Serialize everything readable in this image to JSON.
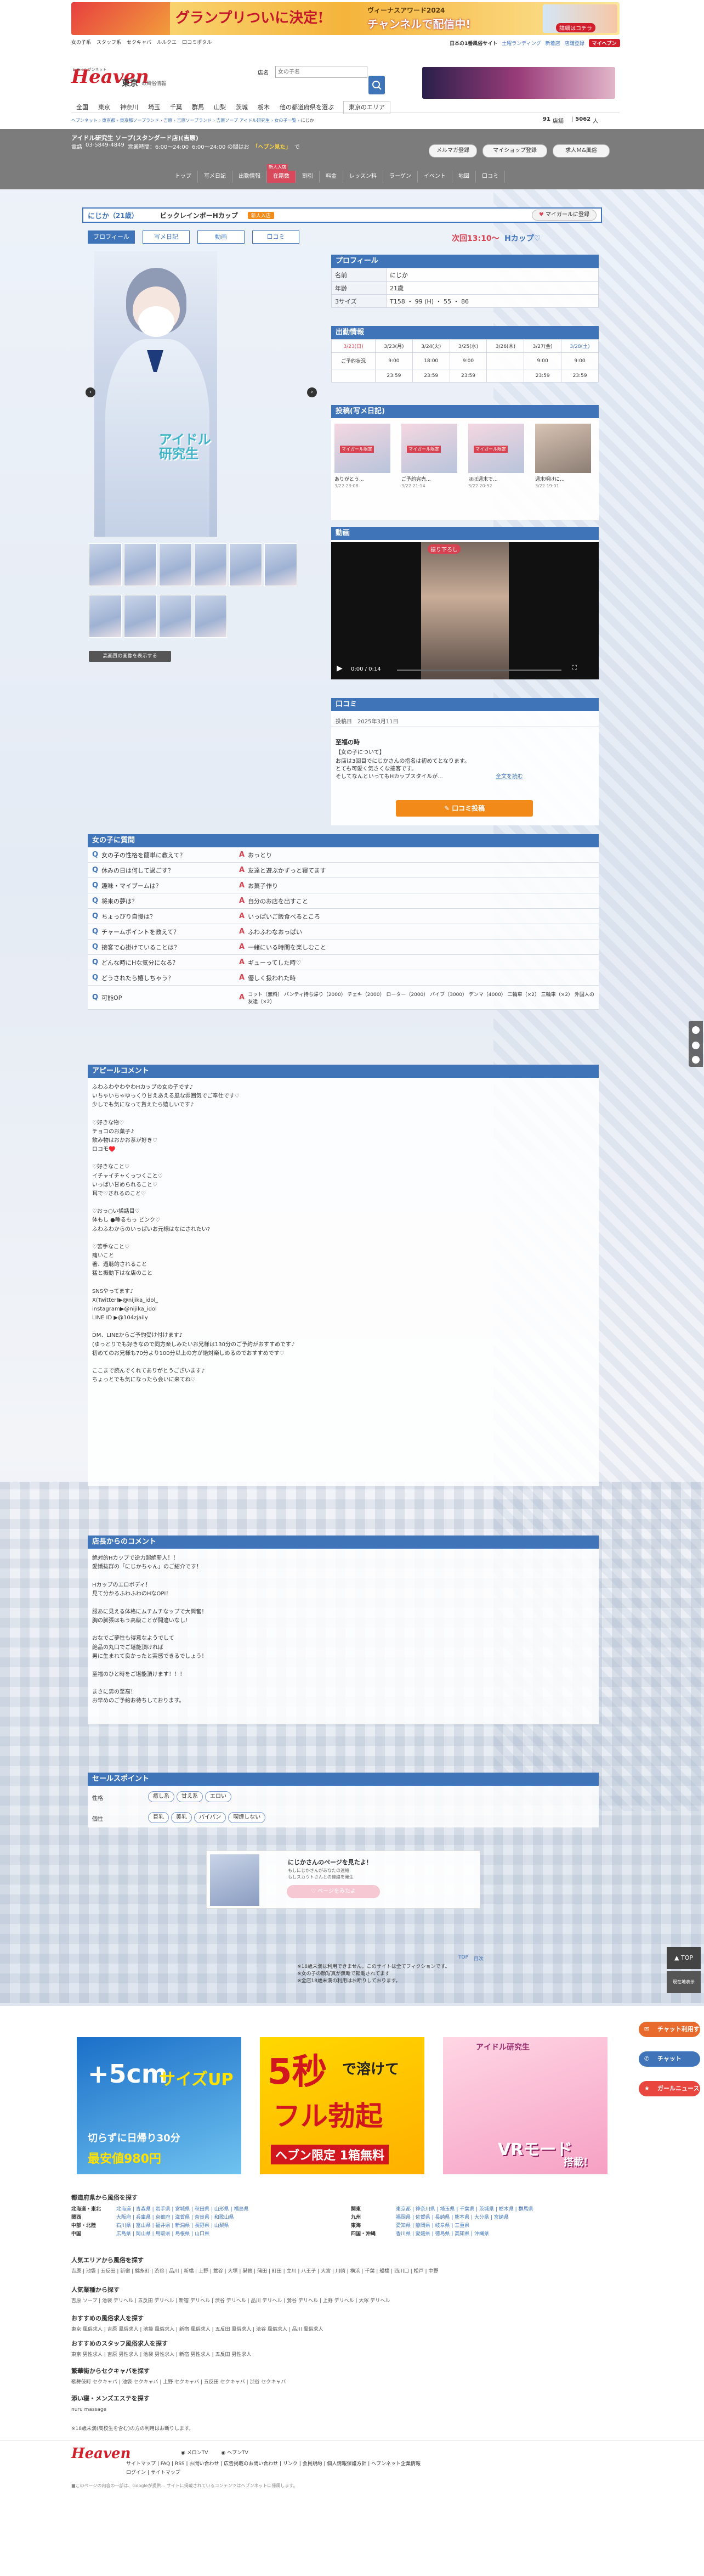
{
  "top_banner": {
    "left_text": "グランプリついに決定!",
    "mid_text": "ヴィーナスアワード2024",
    "right_text": "チャンネルで配信中!",
    "right_sub": "詳細はコチラ"
  },
  "top_links": [
    "女の子系",
    "スタッフ系",
    "セクキャバ",
    "ルルクエ",
    "口コミポタル"
  ],
  "header_promo": {
    "text": "日本の1番風俗サイト",
    "link1": "土曜ランディング",
    "link2": "新着店",
    "link3": "店舗登録"
  },
  "header_promo_badge": "マイヘブン",
  "site": {
    "logo": "Heaven",
    "logo_sub": "シティヘブンネット",
    "region": "東京",
    "region_sub": "の風俗情報"
  },
  "search": {
    "label": "店名",
    "placeholder": "女の子名"
  },
  "nav_items": [
    "全国",
    "東京",
    "神奈川",
    "埼玉",
    "千葉",
    "群馬",
    "山梨",
    "茨城",
    "栃木",
    "他の都道府県を選ぶ",
    "東京のエリア"
  ],
  "breadcrumb": [
    "ヘブンネット",
    "東京都",
    "東京都ソープランド",
    "吉原",
    "吉原ソープランド",
    "吉原ソープ アイドル研究生",
    "女の子一覧",
    "にじか"
  ],
  "counts": {
    "label1": "91",
    "unit1": "店舗",
    "label2": "5062",
    "unit2": "人"
  },
  "shop": {
    "name": "アイドル研究生 ソープ(スタンダード店)(吉原)",
    "tel_label": "電話",
    "tel": "03-5849-4849",
    "hours": "営業時間：6:00～24:00",
    "hours_note": "6:00～24:00 の間はお",
    "highlight": "「ヘブン見た」",
    "highlight_suffix": "で"
  },
  "shop_tabs": [
    "トップ",
    "写メ日記",
    "出勤情報",
    "在籍数",
    "割引",
    "料金",
    "レッスン料",
    "ラーゲン",
    "イベント",
    "地図",
    "口コミ"
  ],
  "shop_tab_badge": "新人入店",
  "header_buttons": {
    "mail": "メルマガ登録",
    "my_shop": "マイショップ登録",
    "recruit": "求人Ｍ&風俗"
  },
  "girl": {
    "name": "にじか",
    "age_tag": "（21歳）",
    "catch": "ビックレインボーHカップ",
    "badge_text": "新人入店",
    "next": "次回13:10～",
    "cup": "Hカップ♡",
    "mygirl_button": "マイガールに登録"
  },
  "profile_tabs": [
    "プロフィール",
    "写メ日記",
    "動画",
    "口コミ"
  ],
  "photo_overlay": "アイドル研究生",
  "photo_button": "高画質の画像を表示する",
  "profile": {
    "title": "プロフィール",
    "rows": [
      {
        "label": "名前",
        "value": "にじか"
      },
      {
        "label": "年齢",
        "value": "21歳"
      },
      {
        "label": "3サイズ",
        "value": "T158 ・ 99 (H) ・ 55 ・ 86"
      }
    ]
  },
  "schedule": {
    "title": "出勤情報",
    "days": [
      "3/23(日)",
      "3/23(月)",
      "3/24(火)",
      "3/25(水)",
      "3/26(木)",
      "3/27(金)",
      "3/28(土)"
    ],
    "row1": [
      "ご予約状況",
      "9:00",
      "18:00",
      "9:00",
      "",
      "9:00",
      "9:00"
    ],
    "row2": [
      "",
      "23:59",
      "23:59",
      "23:59",
      "",
      "23:59",
      "23:59"
    ]
  },
  "diary": {
    "title": "投稿(写メ日記",
    "title_suffix": ")",
    "items": [
      {
        "cap": "ありがとう...",
        "date": "3/22 23:08",
        "tag": "マイガール限定"
      },
      {
        "cap": "ご予約完売...",
        "date": "3/22 21:14",
        "tag": "マイガール限定"
      },
      {
        "cap": "ほぼ週末で...",
        "date": "3/22 20:52",
        "tag": "マイガール限定"
      },
      {
        "cap": "週末明けに...",
        "date": "3/22 19:01",
        "tag": ""
      }
    ]
  },
  "video": {
    "title": "動画",
    "time": "0:00 / 0:14",
    "label": "振り下ろし"
  },
  "review": {
    "title": "口コミ",
    "date_label": "投稿日",
    "date": "2025年3月11日",
    "heading": "至福の時",
    "sub": "【女の子について】",
    "body1": "お店は3回目でにじかさんの指名は初めてとなります。",
    "body2": "とても可愛く気さくな接客です。",
    "body3": "そしてなんといってもHカップスタイルが...",
    "more": "全文を読む",
    "button": "口コミ投稿"
  },
  "qa": {
    "title": "女の子に質問",
    "rows": [
      {
        "q": "女の子の性格を簡単に教えて？",
        "a": "おっとり"
      },
      {
        "q": "休みの日は何して過ごす？",
        "a": "友達と遊ぶかずっと寝てます"
      },
      {
        "q": "趣味・マイブームは？",
        "a": "お菓子作り"
      },
      {
        "q": "将来の夢は？",
        "a": "自分のお店を出すこと"
      },
      {
        "q": "ちょっぴり自慢は？",
        "a": "いっぱいご飯食べるところ"
      },
      {
        "q": "チャームポイントを教えて？",
        "a": "ふわふわなおっぱい"
      },
      {
        "q": "接客で心掛けていることは？",
        "a": "一緒にいる時間を楽しむこと"
      },
      {
        "q": "どんな時にHな気分になる？",
        "a": "ギューってした時♡"
      },
      {
        "q": "どうされたら嬉しちゃう？",
        "a": "優しく扱われた時"
      },
      {
        "q": "可能OP",
        "a": "コット（無料） パンティ持ち帰り（2000） チェキ（2000） ローター（2000） バイブ（3000） デンマ（4000） 二輪車（×2） 三輪車（×2） 外国人の友達（×2）"
      }
    ]
  },
  "appeal": {
    "title": "アピールコメント",
    "lines": [
      "ふわふわやわやわHカップの女の子です♪",
      "いちゃいちゃゆっくり甘えあえる風な雰囲気でご奉仕です♡",
      "少しでも気になって貰えたら嬉しいです♪",
      "",
      "♡好きな物♡",
      "チョコのお菓子♪",
      "飲み物はおかお茶が好き♡",
      "ロコモ♥️",
      "",
      "♡好きなこと♡",
      "イチャイチャくっつくこと♡",
      "いっぱい甘められること♡",
      "耳で♡されるのこと♡",
      "",
      "♡おっ○い揉話目♡",
      "体もし ●唾るもっ ピンク♡",
      "ふわふわからのいっぱいお元様はなにされたい?",
      "",
      "♡苦手なこと♡",
      "痛いこと",
      "著、過聴的されること",
      "猛と振動下はな店のこと",
      "",
      "SNSやってます♪",
      "X(Twitter)▶@nijika_idol_",
      "instagram▶@nijika_idol",
      "LINE ID ▶@104zjaily",
      "",
      "DM、LINEからご予約受け付けます♪",
      "(ゆっとりでも好きなので同方楽しみたいお兄様は130分のご予約がおすすめです♪",
      "初めてのお兄様も70分より100分以上の方が絶対楽しめるのでおすすめです♡",
      "",
      "ここまで読んでくれてありがとうございます♪",
      "ちょっとでも気になったら会いに来てね♡"
    ]
  },
  "shop_comment": {
    "title": "店長からのコメント",
    "lines": [
      "絶対的Hカップで逆力超絶新人！！",
      "愛嬌抜群の「にじかちゃん」のご紹介です！",
      "",
      "Hカップのエロボディ！",
      "見て分かるふわふわのHなOPⅠ！",
      "",
      "服あに見える体格にムチムチなップで大興奮！",
      "胸の膨張はもう高級ことが間違いなし！",
      "",
      "おなでご夢性も得意なようでして",
      "絶品の丸口でご堪能頂ければ",
      "男に生まれて良かったと実感できるでしょう！",
      "",
      "至福のひと時をご堪能頂けます！！！",
      "",
      "まさに男の至高！",
      "お早めのご予約お待ちしております。"
    ]
  },
  "sales": {
    "title": "セールスポイント",
    "row1_label": "性格",
    "row1": [
      "癒し系",
      "甘え系",
      "エロい"
    ],
    "row2_label": "個性",
    "row2": [
      "巨乳",
      "美乳",
      "パイパン",
      "喫煙しない"
    ]
  },
  "mypage_card": {
    "title": "にじかさんのページを見たよ！",
    "line1": "もしにじかさんがあなたの連絡",
    "line2": "もしスカウトさんとの連絡を発生",
    "button": "ページをみたよ"
  },
  "info_notes": [
    "※18歳未満は利用できません。このサイトは全てフィクションです。",
    "※女の子の顔写真が無断で転載されてます",
    "※全店18歳未満の利用はお断りしております。"
  ],
  "info_links": [
    "TOP",
    "目次"
  ],
  "side_buttons": [
    {
      "label": "チャット利用する",
      "color": "#e86a2c"
    },
    {
      "label": "チャット",
      "color": "#3f74b9"
    },
    {
      "label": "ガールニュース",
      "color": "#e8463f"
    }
  ],
  "side_top_label": "TOP",
  "side_menu_label": "現在地表示",
  "ads": [
    {
      "big": "+5cm",
      "mid": "サイズUP",
      "small": "切らずに日帰り30分",
      "price": "最安値980円"
    },
    {
      "big": "5秒",
      "mid": "で溶けて",
      "small": "フル勃起",
      "price": "ヘブン限定 1箱無料"
    },
    {
      "big": "VRモード",
      "mid": "搭載！",
      "small": "アイドル研究生",
      "price": ""
    }
  ],
  "footer": {
    "pref_title": "都道府県から風俗を探す",
    "prefs": [
      {
        "region": "北海道・東北",
        "list": "北海道 | 青森県 | 岩手県 | 宮城県 | 秋田県 | 山形県 | 福島県"
      },
      {
        "region": "関東",
        "list": "東京都 | 神奈川県 | 埼玉県 | 千葉県 | 茨城県 | 栃木県 | 群馬県"
      },
      {
        "region": "関西",
        "list": "大阪府 | 兵庫県 | 京都府 | 滋賀県 | 奈良県 | 和歌山県"
      },
      {
        "region": "九州",
        "list": "福岡県 | 佐賀県 | 長崎県 | 熊本県 | 大分県 | 宮崎県"
      },
      {
        "region": "中部・北陸",
        "list": "石川県 | 富山県 | 福井県 | 新潟県 | 長野県 | 山梨県"
      },
      {
        "region": "東海",
        "list": "愛知県 | 静岡県 | 岐阜県 | 三重県"
      },
      {
        "region": "中国",
        "list": "広島県 | 岡山県 | 鳥取県 | 島根県 | 山口県"
      },
      {
        "region": "四国・沖縄",
        "list": "香川県 | 愛媛県 | 徳島県 | 高知県 | 沖縄県"
      }
    ],
    "area_title": "人気エリアから風俗を探す",
    "area_list": "吉原 | 池袋 | 五反田 | 新宿 | 錦糸町 | 渋谷 | 品川 | 新橋 | 上野 | 鶯谷 | 大塚 | 巣鴨 | 蒲田 | 町田 | 立川 | 八王子 | 大宮 | 川崎 | 横浜 | 千葉 | 船橋 | 西川口 | 松戸 | 中野",
    "type_title": "人気業種から探す",
    "type_list": "吉原 ソープ | 池袋 デリヘル | 五反田 デリヘル | 新宿 デリヘル | 渋谷 デリヘル | 品川 デリヘル | 鶯谷 デリヘル | 上野 デリヘル | 大塚 デリヘル",
    "rec_title": "おすすめの風俗求人を探す",
    "rec_list": "東京 風俗求人 | 吉原 風俗求人 | 池袋 風俗求人 | 新宿 風俗求人 | 五反田 風俗求人 | 渋谷 風俗求人 | 品川 風俗求人",
    "staff_title": "おすすめのスタッフ風俗求人を探す",
    "staff_list": "東京 男性求人 | 吉原 男性求人 | 池袋 男性求人 | 新宿 男性求人 | 五反田 男性求人",
    "cabaret_title": "繁華街からセクキャバを探す",
    "cabaret_list": "歌舞伎町 セクキャバ | 池袋 セクキャバ | 上野 セクキャバ | 五反田 セクキャバ | 渋谷 セクキャバ",
    "msg_title": "添い寝・メンズエステを探す",
    "msg_list": "nuru massage",
    "age_note": "※18歳未満(高校生を含む)の方の利用はお断りします。",
    "bottom_logo": "Heaven",
    "bottom_links": [
      "メロンTV",
      "ヘブンTV"
    ],
    "bottom_nav": "サイトマップ | FAQ | RSS | お問い合わせ | 広告掲載のお問い合わせ | リンク | 会員規約 | 個人情報保護方針 | ヘブンネット企業情報",
    "bottom_nav2": "ログイン | サイトマップ",
    "copyright": "■このページの内容の一部は、Googleが提供... サイトに掲載されているコンテンツはヘブンネットに帰属します。"
  }
}
